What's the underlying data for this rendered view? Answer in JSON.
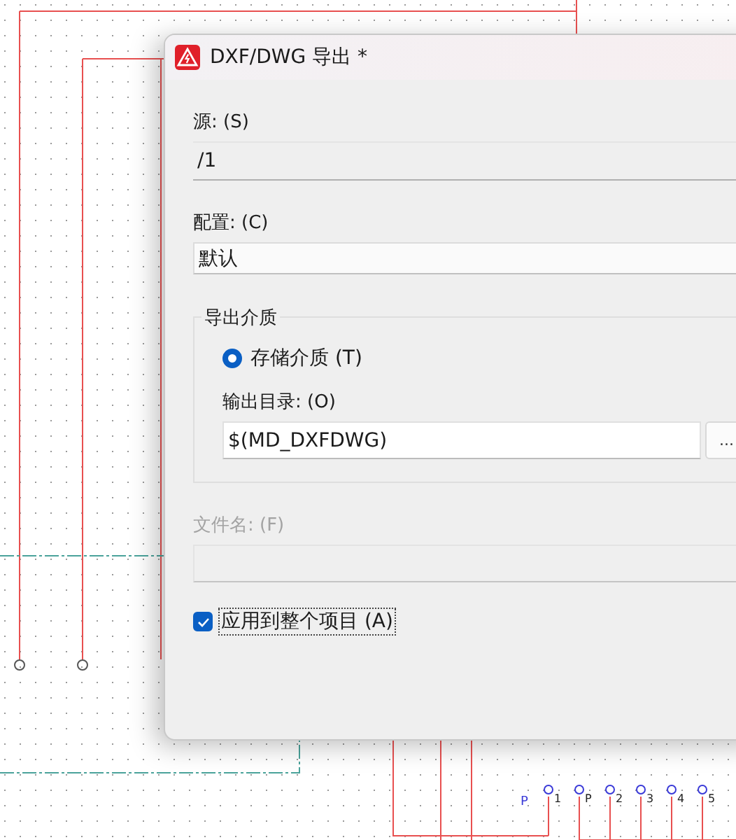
{
  "window": {
    "title": "DXF/DWG 导出 *"
  },
  "source": {
    "label": "源: (S)",
    "value": "/1"
  },
  "config": {
    "label": "配置: (C)",
    "value": "默认"
  },
  "export_medium": {
    "title": "导出介质",
    "options": [
      {
        "label": "存储介质 (T)",
        "selected": true
      }
    ],
    "output_dir": {
      "label": "输出目录: (O)",
      "value": "$(MD_DXFDWG)",
      "browse_button": "..."
    }
  },
  "file_name": {
    "label": "文件名: (F)",
    "disabled": true
  },
  "apply_all": {
    "label": "应用到整个项目 (A)",
    "checked": true
  },
  "schematic": {
    "pin_labels": [
      "1",
      "P",
      "2",
      "3",
      "4",
      "5"
    ],
    "signal_label": "P"
  }
}
